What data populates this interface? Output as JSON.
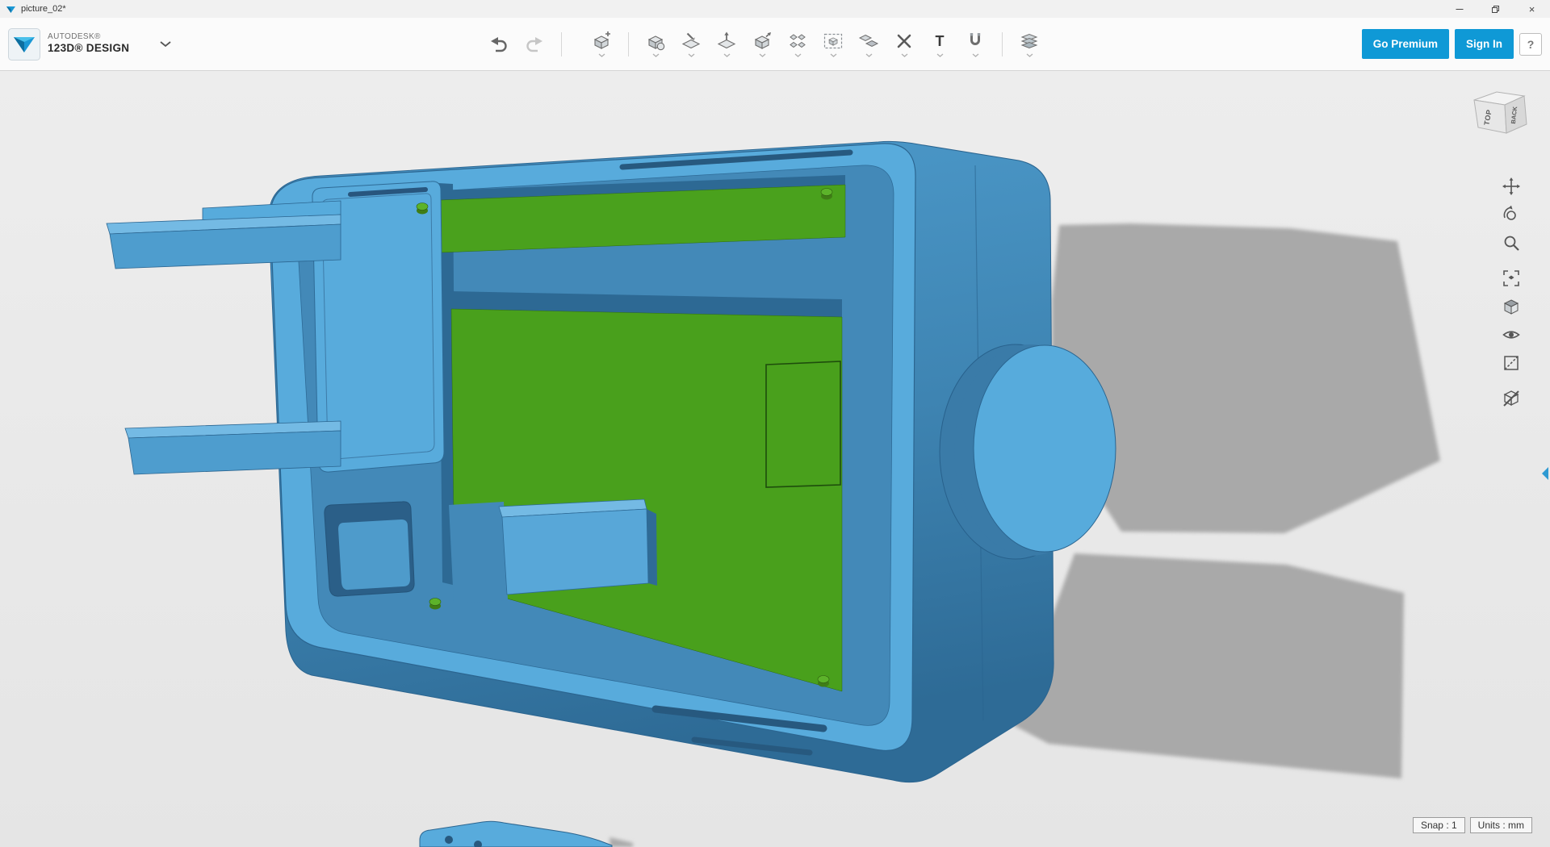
{
  "window": {
    "title": "picture_02*"
  },
  "brand": {
    "line1": "AUTODESK®",
    "line2": "123D® DESIGN"
  },
  "toolbar": {
    "buttons": {
      "go_premium": "Go Premium",
      "sign_in": "Sign In",
      "help": "?"
    },
    "text_tool_label": "T",
    "tool_names": [
      "undo",
      "redo",
      "transform",
      "primitives",
      "sketch",
      "construct",
      "modify",
      "pattern",
      "grouping",
      "combine",
      "measure",
      "text",
      "snap",
      "material"
    ]
  },
  "viewcube": {
    "top": "TOP",
    "back": "BACK"
  },
  "nav_rail": {
    "icons": [
      "pan",
      "orbit",
      "zoom",
      "fit-view",
      "shading",
      "visibility",
      "hidden-edges",
      "material-visibility"
    ]
  },
  "statusbar": {
    "snap": "Snap : 1",
    "units": "Units : mm"
  },
  "scene": {
    "description": "Blue rounded rectangular enclosure opened toward viewer with green PCB inside, two mounting prong clips extending left, cylindrical knob on right end, gray drop shadows on ground, second small blue part at bottom edge",
    "colors": {
      "case_light": "#58abdc",
      "case_mid": "#4389b8",
      "case_dark": "#2d6994",
      "pcb_green": "#49a01c",
      "peg_green": "#5cb32a",
      "shadow": "#a9a9a9",
      "viewport_bg": "#e9e9e9",
      "accent_blue": "#0f99d6"
    }
  }
}
